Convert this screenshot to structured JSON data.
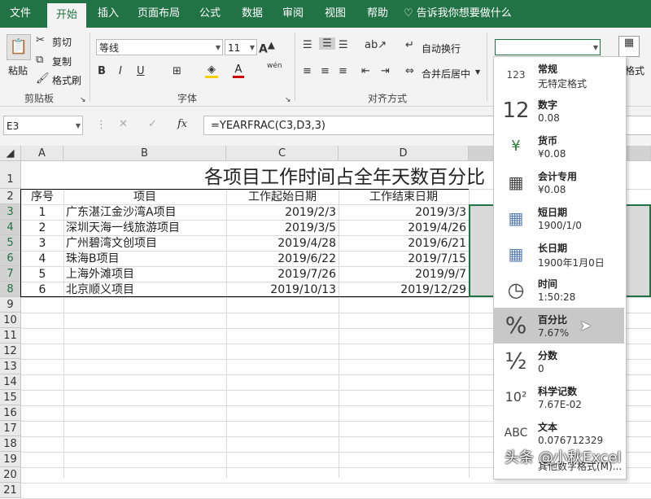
{
  "tabs": [
    "文件",
    "开始",
    "插入",
    "页面布局",
    "公式",
    "数据",
    "审阅",
    "视图",
    "帮助"
  ],
  "active_tab": "开始",
  "tell_me": "告诉我你想要做什么",
  "clipboard": {
    "paste": "粘贴",
    "cut": "剪切",
    "copy": "复制",
    "format_painter": "格式刷",
    "group": "剪贴板"
  },
  "font": {
    "name": "等线",
    "size": "11",
    "bold": "B",
    "italic": "I",
    "underline": "U",
    "phonetic": "wén",
    "group": "字体"
  },
  "alignment": {
    "wrap": "自动换行",
    "merge": "合并后居中",
    "group": "对齐方式"
  },
  "number_format_value": "",
  "ribbon_right": {
    "format": "格式"
  },
  "name_box": "E3",
  "formula": "=YEARFRAC(C3,D3,3)",
  "fx": "fx",
  "columns": [
    "A",
    "B",
    "C",
    "D"
  ],
  "row_numbers": [
    "1",
    "2",
    "3",
    "4",
    "5",
    "6",
    "7",
    "8",
    "9",
    "10",
    "11",
    "12",
    "13",
    "14",
    "15",
    "16",
    "17",
    "18",
    "19",
    "20",
    "21"
  ],
  "sheet": {
    "title": "各项目工作时间占全年天数百分比",
    "headers": [
      "序号",
      "项目",
      "工作起始日期",
      "工作结束日期"
    ],
    "rows": [
      [
        "1",
        "广东湛江金沙湾A项目",
        "2019/2/3",
        "2019/3/3"
      ],
      [
        "2",
        "深圳天海一线旅游项目",
        "2019/3/5",
        "2019/4/26"
      ],
      [
        "3",
        "广州碧湾文创项目",
        "2019/4/28",
        "2019/6/21"
      ],
      [
        "4",
        "珠海B项目",
        "2019/6/22",
        "2019/7/15"
      ],
      [
        "5",
        "上海外滩项目",
        "2019/7/26",
        "2019/9/7"
      ],
      [
        "6",
        "北京顺义项目",
        "2019/10/13",
        "2019/12/29"
      ]
    ]
  },
  "formats": [
    {
      "name": "常规",
      "sample": "无特定格式",
      "icon": "clock-123-icon",
      "glyph": "123"
    },
    {
      "name": "数字",
      "sample": "0.08",
      "icon": "number-12-icon",
      "glyph": "12"
    },
    {
      "name": "货币",
      "sample": "¥0.08",
      "icon": "currency-icon",
      "glyph": "¥"
    },
    {
      "name": "会计专用",
      "sample": " ¥0.08",
      "icon": "calculator-icon",
      "glyph": "▦"
    },
    {
      "name": "短日期",
      "sample": "1900/1/0",
      "icon": "calendar-icon",
      "glyph": "▦"
    },
    {
      "name": "长日期",
      "sample": "1900年1月0日",
      "icon": "calendar-icon",
      "glyph": "▦"
    },
    {
      "name": "时间",
      "sample": "1:50:28",
      "icon": "clock-icon",
      "glyph": "◷"
    },
    {
      "name": "百分比",
      "sample": "7.67%",
      "icon": "percent-icon",
      "glyph": "%"
    },
    {
      "name": "分数",
      "sample": "0",
      "icon": "fraction-icon",
      "glyph": "½"
    },
    {
      "name": "科学记数",
      "sample": "7.67E-02",
      "icon": "scientific-icon",
      "glyph": "10²"
    },
    {
      "name": "文本",
      "sample": "0.076712329",
      "icon": "text-abc-icon",
      "glyph": "ABC"
    }
  ],
  "more_formats": "其他数字格式(M)...",
  "watermark": "头条 @小秋Excel"
}
